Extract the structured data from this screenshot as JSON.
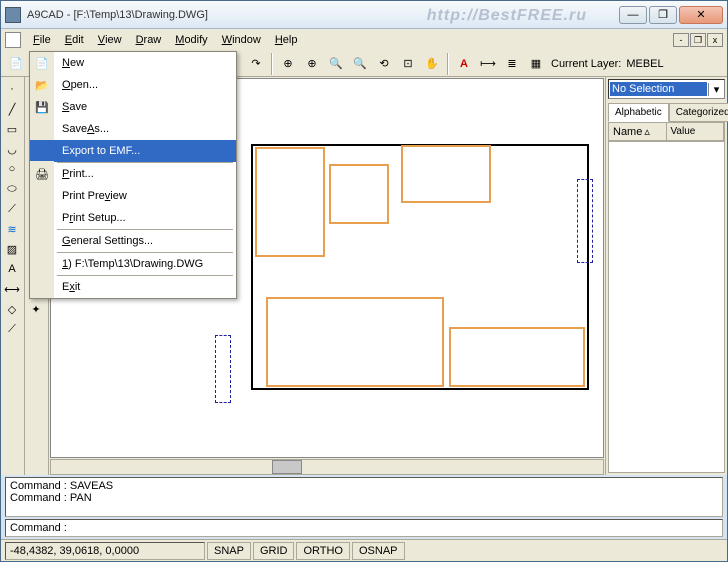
{
  "title": "A9CAD - [F:\\Temp\\13\\Drawing.DWG]",
  "watermark": "http://BestFREE.ru",
  "menus": {
    "file": "File",
    "edit": "Edit",
    "view": "View",
    "draw": "Draw",
    "modify": "Modify",
    "window": "Window",
    "help": "Help"
  },
  "file_menu": {
    "new": "New",
    "open": "Open...",
    "save": "Save",
    "saveas": "Save As...",
    "export": "Export to EMF...",
    "print": "Print...",
    "preview": "Print Preview",
    "setup": "Print Setup...",
    "settings": "General Settings...",
    "recent": "1) F:\\Temp\\13\\Drawing.DWG",
    "exit": "Exit"
  },
  "layer": {
    "label": "Current Layer:",
    "value": "MEBEL"
  },
  "right": {
    "selection": "No Selection",
    "tab_alpha": "Alphabetic",
    "tab_cat": "Categorized",
    "col_name": "Name",
    "col_value": "Value"
  },
  "cmd": {
    "line1": "Command : SAVEAS",
    "line2": "Command : PAN",
    "prompt": "Command :"
  },
  "status": {
    "coords": "-48,4382, 39,0618, 0,0000",
    "snap": "SNAP",
    "grid": "GRID",
    "ortho": "ORTHO",
    "osnap": "OSNAP"
  }
}
